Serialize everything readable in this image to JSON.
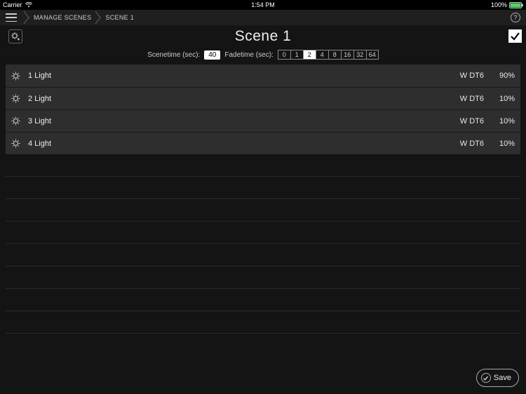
{
  "statusbar": {
    "carrier": "Carrier",
    "time": "1:54 PM",
    "battery_pct": "100%"
  },
  "navbar": {
    "breadcrumbs": [
      "MANAGE SCENES",
      "SCENE 1"
    ],
    "help_label": "?"
  },
  "title": "Scene 1",
  "scenetime": {
    "label": "Scenetime (sec):",
    "value": "40"
  },
  "fadetime": {
    "label": "Fadetime (sec):",
    "options": [
      "0",
      "1",
      "2",
      "4",
      "8",
      "16",
      "32",
      "64"
    ],
    "selected_index": 2
  },
  "lights": [
    {
      "name": "1 Light",
      "type": "W DT6",
      "percent": "90%"
    },
    {
      "name": "2 Light",
      "type": "W DT6",
      "percent": "10%"
    },
    {
      "name": "3 Light",
      "type": "W DT6",
      "percent": "10%"
    },
    {
      "name": "4 Light",
      "type": "W DT6",
      "percent": "10%"
    }
  ],
  "empty_row_count": 8,
  "save_label": "Save",
  "icons": {
    "hamburger": "hamburger-icon",
    "wifi": "wifi-icon",
    "battery": "battery-icon",
    "chevron": "chevron-right-icon",
    "help": "help-icon",
    "add_light": "add-light-icon",
    "checkmark": "checkmark-icon",
    "light": "light-icon"
  }
}
